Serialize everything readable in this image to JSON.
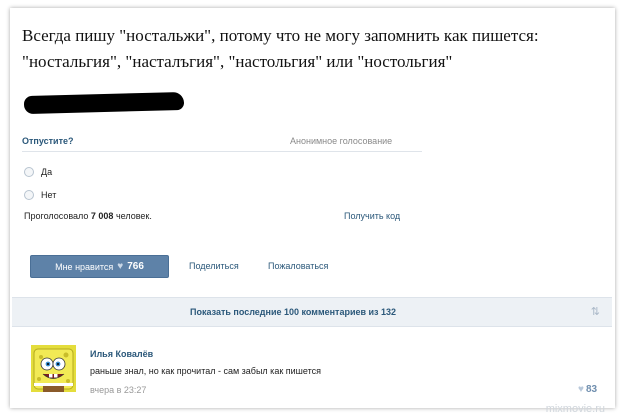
{
  "post": {
    "text_line1": "Всегда пишу \"ностальжи\", потому что не могу запомнить как пишется:",
    "text_line2": "\"ностальгия\", \"насталъгия\", \"настольгия\" или \"ностольгия\""
  },
  "poll": {
    "question": "Отпустите?",
    "type": "Анонимное голосование",
    "options": [
      {
        "label": "Да"
      },
      {
        "label": "Нет"
      }
    ],
    "votes_prefix": "Проголосовало",
    "votes_count": "7 008",
    "votes_suffix": "человек.",
    "get_code": "Получить код"
  },
  "actions": {
    "like_label": "Мне нравится",
    "like_count": "766",
    "share": "Поделиться",
    "report": "Пожаловаться"
  },
  "comments": {
    "show_all": "Показать последние 100 комментариев из 132",
    "items": [
      {
        "author": "Илья Ковалёв",
        "text": "раньше знал, но как прочитал - сам забыл как пишется",
        "time": "вчера в 23:27",
        "likes": "83"
      }
    ]
  },
  "watermark": "mixmovie.ru",
  "colors": {
    "link": "#2b587a",
    "button": "#5e82a8",
    "bar": "#edf1f5"
  },
  "icons": [
    "heart-icon",
    "radio-icon",
    "collapse-arrows-icon",
    "avatar-image"
  ]
}
